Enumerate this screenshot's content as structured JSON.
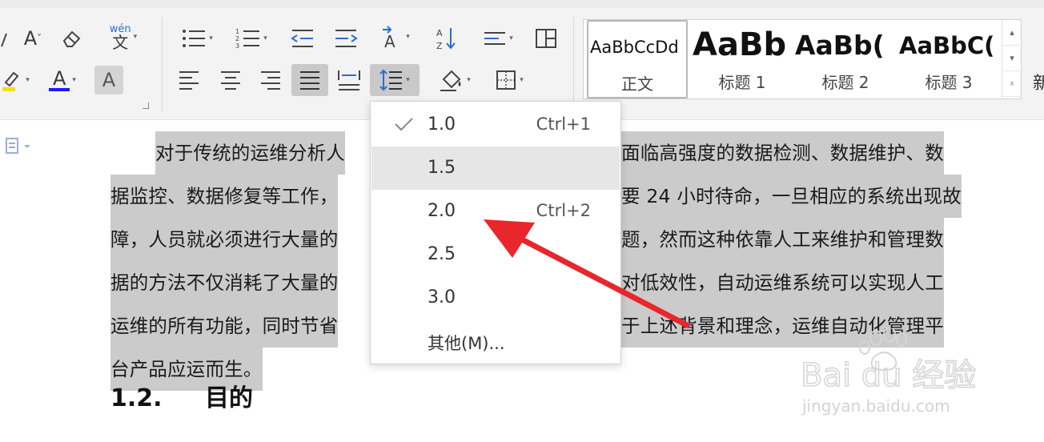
{
  "ribbon": {
    "font_buttons": {
      "font_shrink_label": "A",
      "pinyin_label": "wén",
      "pinyin_char": "文",
      "font_color_label": "A",
      "char_shading_label": "A"
    },
    "styles": [
      {
        "sample": "AaBbCcDd",
        "name": "正文",
        "selected": true
      },
      {
        "sample": "AaBb",
        "name": "标题 1",
        "selected": false
      },
      {
        "sample": "AaBb(",
        "name": "标题 2",
        "selected": false
      },
      {
        "sample": "AaBbC(",
        "name": "标题 3",
        "selected": false
      }
    ],
    "cut_off_text": "新"
  },
  "line_spacing_menu": {
    "items": [
      {
        "value": "1.0",
        "shortcut": "Ctrl+1",
        "checked": true
      },
      {
        "value": "1.5",
        "shortcut": "",
        "checked": false,
        "hovered": true
      },
      {
        "value": "2.0",
        "shortcut": "Ctrl+2",
        "checked": false
      },
      {
        "value": "2.5",
        "shortcut": "",
        "checked": false
      },
      {
        "value": "3.0",
        "shortcut": "",
        "checked": false
      },
      {
        "value": "其他(M)...",
        "shortcut": "",
        "checked": false
      }
    ]
  },
  "document": {
    "paragraph_lines": {
      "line1_left": "对于传统的运维分析人",
      "line1_right": "面临高强度的数据检测、数据维护、数",
      "line2_left": "据监控、数据修复等工作，",
      "line2_right": "要 24 小时待命，一旦相应的系统出现故",
      "line3_left": "障，人员就必须进行大量的",
      "line3_right": "题，然而这种依靠人工来维护和管理数",
      "line4_left": "据的方法不仅消耗了大量的",
      "line4_right": "对低效性，自动运维系统可以实现人工",
      "line5_left": "运维的所有功能，同时节省",
      "line5_right": "于上述背景和理念，运维自动化管理平",
      "line6": "台产品应运而生。"
    },
    "heading_number": "1.2.",
    "heading_text": "目的"
  },
  "watermark": {
    "brand": "Bai du 经验",
    "url": "jingyan.baidu.com"
  },
  "colors": {
    "highlight": "#cbcbcb",
    "font_color_underline": "#1a1aff",
    "highlighter_underline": "#f5e000",
    "arrow": "#e8262b"
  }
}
